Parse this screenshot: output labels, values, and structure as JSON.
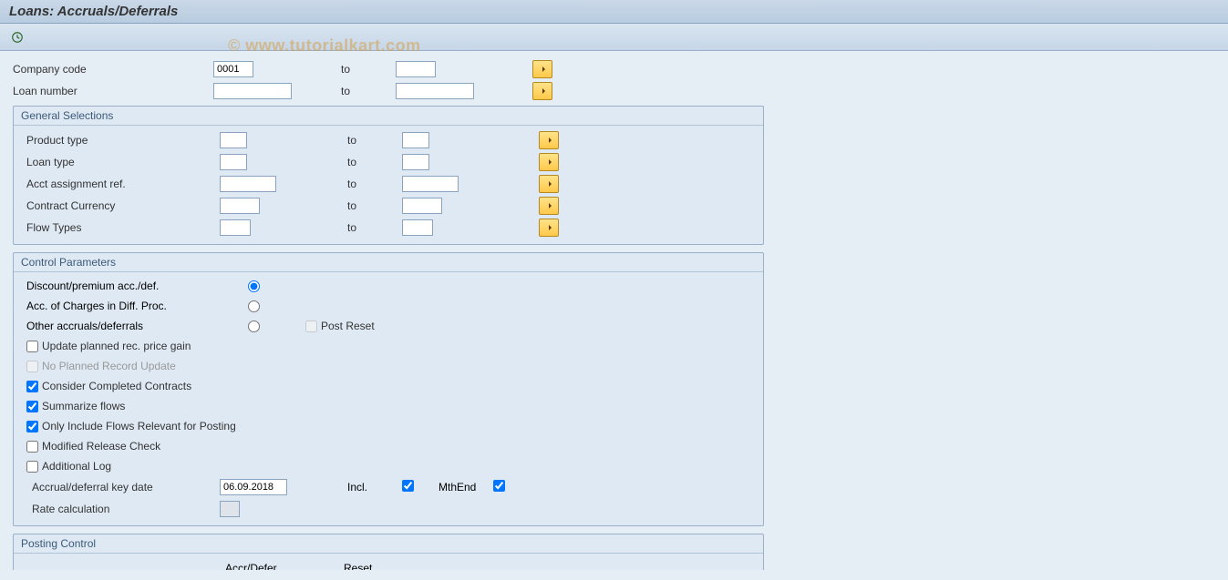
{
  "title": "Loans: Accruals/Deferrals",
  "watermark": "© www.tutorialkart.com",
  "top_fields": {
    "company_code": {
      "label": "Company code",
      "from": "0001",
      "to_label": "to",
      "to": ""
    },
    "loan_number": {
      "label": "Loan number",
      "from": "",
      "to_label": "to",
      "to": ""
    }
  },
  "general_selections": {
    "title": "General Selections",
    "rows": {
      "product_type": {
        "label": "Product type",
        "from": "",
        "to_label": "to",
        "to": ""
      },
      "loan_type": {
        "label": "Loan type",
        "from": "",
        "to_label": "to",
        "to": ""
      },
      "acct_assign_ref": {
        "label": "Acct assignment ref.",
        "from": "",
        "to_label": "to",
        "to": ""
      },
      "contract_currency": {
        "label": "Contract Currency",
        "from": "",
        "to_label": "to",
        "to": ""
      },
      "flow_types": {
        "label": "Flow Types",
        "from": "",
        "to_label": "to",
        "to": ""
      }
    }
  },
  "control_parameters": {
    "title": "Control Parameters",
    "radio": {
      "discount": "Discount/premium acc./def.",
      "acc_charges": "Acc. of Charges in Diff. Proc.",
      "other": "Other accruals/deferrals",
      "selected": "discount",
      "post_reset_label": "Post Reset",
      "post_reset_checked": false
    },
    "checks": {
      "update_planned": {
        "label": "Update planned rec. price gain",
        "checked": false,
        "disabled": false
      },
      "no_planned": {
        "label": "No Planned Record Update",
        "checked": false,
        "disabled": true
      },
      "consider_completed": {
        "label": "Consider Completed Contracts",
        "checked": true,
        "disabled": false
      },
      "summarize": {
        "label": "Summarize flows",
        "checked": true,
        "disabled": false
      },
      "only_include": {
        "label": "Only Include Flows Relevant for Posting",
        "checked": true,
        "disabled": false
      },
      "modified_release": {
        "label": "Modified Release Check",
        "checked": false,
        "disabled": false
      },
      "additional_log": {
        "label": "Additional Log",
        "checked": false,
        "disabled": false
      }
    },
    "key_date": {
      "label": "Accrual/deferral key date",
      "value": "06.09.2018",
      "incl_label": "Incl.",
      "incl_checked": true,
      "mthend_label": "MthEnd",
      "mthend_checked": true
    },
    "rate_calc": {
      "label": "Rate calculation",
      "value": ""
    }
  },
  "posting_control": {
    "title": "Posting Control",
    "col_accr": "Accr/Defer",
    "col_reset": "Reset"
  }
}
